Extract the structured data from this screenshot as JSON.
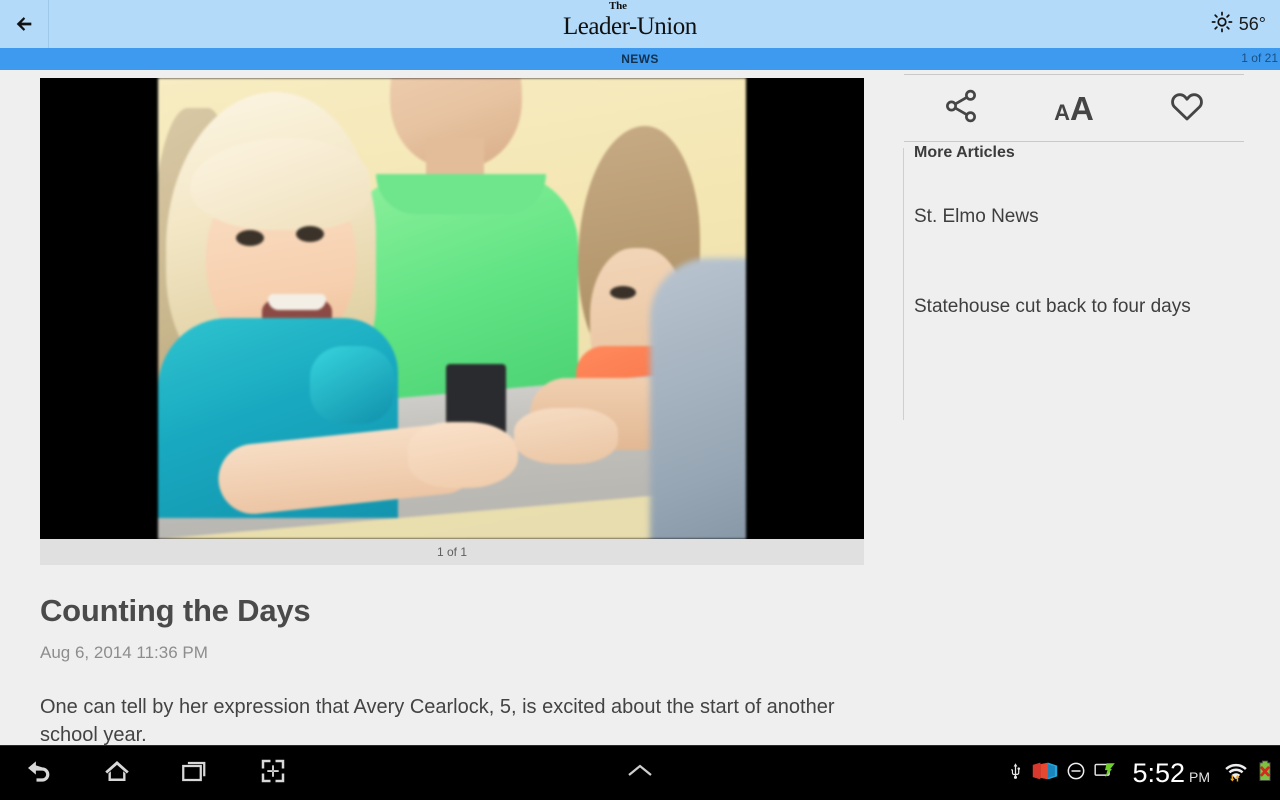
{
  "appbar": {
    "back_icon": "arrow-left-icon",
    "logo_the": "The",
    "logo_name": "Leader-Union",
    "weather_icon": "sun-icon",
    "temperature": "56°"
  },
  "sectionbar": {
    "label": "NEWS",
    "counter": "1 of 21"
  },
  "article": {
    "photo_caption": "1 of 1",
    "title": "Counting the Days",
    "date": "Aug 6, 2014 11:36 PM",
    "body": "One can tell by her expression that Avery Cearlock, 5, is excited about the start of another school year."
  },
  "sidebar": {
    "actions": [
      {
        "name": "share-icon",
        "label": "Share"
      },
      {
        "name": "text-size-icon",
        "small": "A",
        "big": "A"
      },
      {
        "name": "heart-icon",
        "label": "Favorite"
      }
    ],
    "more_title": "More Articles",
    "more_items": [
      {
        "label": "St. Elmo News"
      },
      {
        "label": "Statehouse cut back to four days"
      }
    ]
  },
  "navbar": {
    "buttons": [
      {
        "name": "back-icon",
        "label": "Back"
      },
      {
        "name": "home-icon",
        "label": "Home"
      },
      {
        "name": "recent-apps-icon",
        "label": "Recent apps"
      },
      {
        "name": "screenshot-icon",
        "label": "Screenshot"
      }
    ],
    "center": {
      "name": "chevron-up-icon",
      "label": "Expand"
    },
    "status": {
      "usb": "usb-icon",
      "media": "media-icon",
      "dnd": "do-not-disturb-icon",
      "cast": "screen-cast-icon",
      "time": "5:52",
      "ampm": "PM",
      "wifi": "wifi-icon",
      "battery": "battery-error-icon"
    }
  },
  "colors": {
    "appbar_bg": "#b3daf8",
    "section_bg": "#3d9aef",
    "page_bg": "#efefef",
    "caption_bg": "#e0e0e0",
    "navbar_bg": "#000000"
  }
}
